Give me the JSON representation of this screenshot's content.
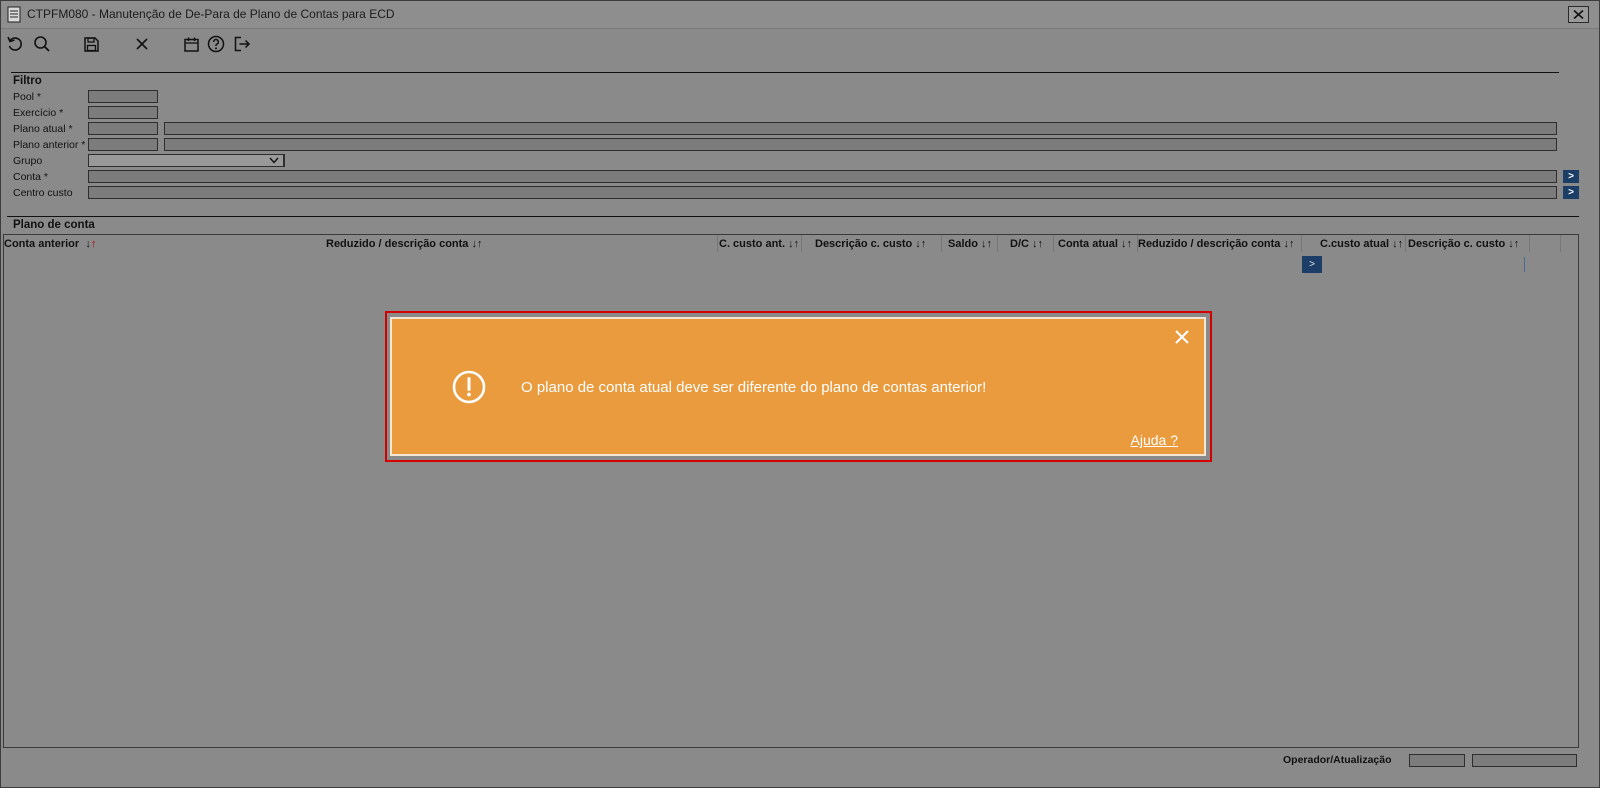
{
  "window": {
    "title": "CTPFM080 - Manutenção de De-Para de Plano de Contas para ECD"
  },
  "toolbar": {
    "buttons": [
      {
        "name": "undo-icon"
      },
      {
        "name": "search-icon"
      },
      {
        "name": "save-icon"
      },
      {
        "name": "close-icon"
      },
      {
        "name": "calendar-icon"
      },
      {
        "name": "help-icon"
      },
      {
        "name": "exit-icon"
      }
    ]
  },
  "filter": {
    "title": "Filtro",
    "pool_label": "Pool *",
    "exercicio_label": "Exercício *",
    "plano_atual_label": "Plano atual *",
    "plano_anterior_label": "Plano anterior *",
    "grupo_label": "Grupo",
    "conta_label": "Conta *",
    "centro_custo_label": "Centro custo",
    "lookup_glyph": ">"
  },
  "grid": {
    "title": "Plano de conta",
    "columns": [
      {
        "label": "Conta anterior",
        "sort": "↓↑"
      },
      {
        "label": "Reduzido / descrição conta",
        "sort": "↓↑"
      },
      {
        "label": "C. custo ant.",
        "sort": "↓↑"
      },
      {
        "label": "Descrição c. custo",
        "sort": "↓↑"
      },
      {
        "label": "Saldo",
        "sort": "↓↑"
      },
      {
        "label": "D/C",
        "sort": "↓↑"
      },
      {
        "label": "Conta atual",
        "sort": "↓↑"
      },
      {
        "label": "Reduzido / descrição conta",
        "sort": "↓↑"
      },
      {
        "label": "C.custo atual",
        "sort": "↓↑"
      },
      {
        "label": "Descrição c. custo",
        "sort": "↓↑"
      }
    ],
    "row_lookup_glyph": ">"
  },
  "footer": {
    "operador_label": "Operador/Atualização"
  },
  "alert": {
    "message": "O plano de conta atual deve ser diferente do plano de contas anterior!",
    "help_link": "Ajuda ?",
    "icon": "exclamation-circle-icon",
    "background": "#e99b3d",
    "highlight_border": "#d40000"
  }
}
